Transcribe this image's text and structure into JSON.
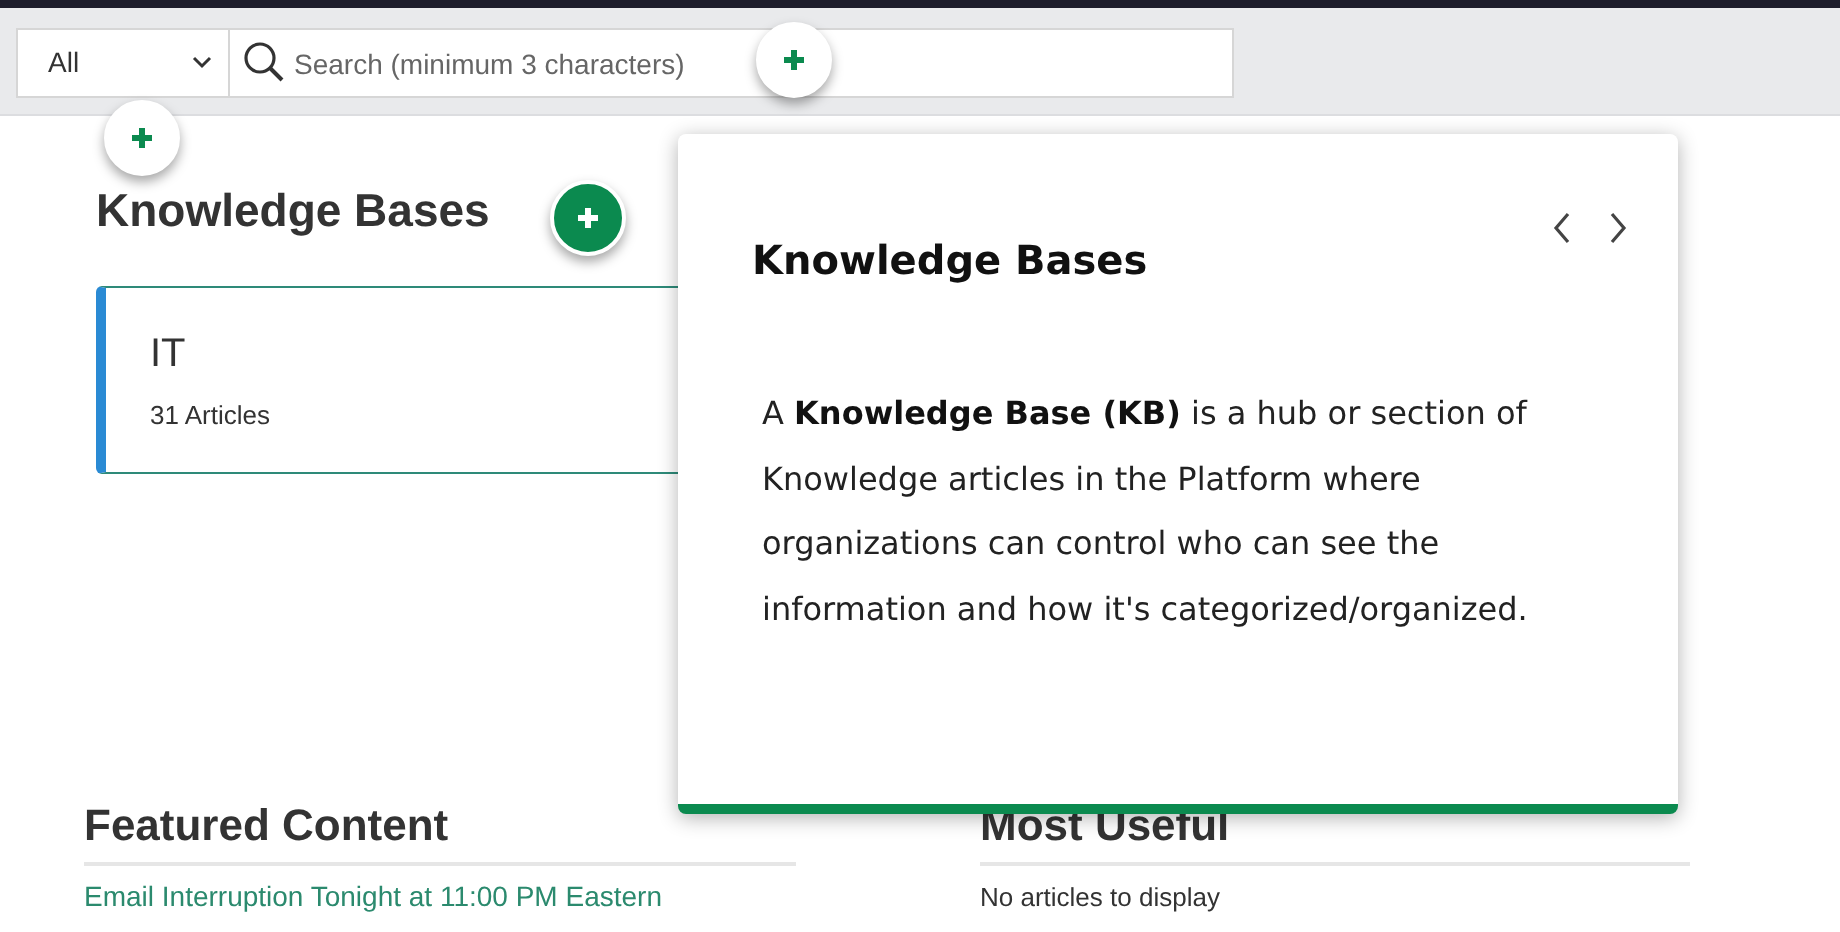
{
  "top_bar": {
    "filter": {
      "value": "All",
      "hotspot": {
        "selected": false
      }
    },
    "search": {
      "placeholder": "Search (minimum 3 characters)",
      "hotspot": {
        "selected": false
      }
    }
  },
  "knowledge_bases": {
    "heading": "Knowledge Bases",
    "hotspot": {
      "selected": true
    },
    "items": [
      {
        "name": "IT",
        "count": "31 Articles"
      }
    ]
  },
  "featured_content": {
    "heading": "Featured Content",
    "links": [
      "Email Interruption Tonight at 11:00 PM Eastern"
    ]
  },
  "most_useful": {
    "heading": "Most Useful",
    "empty_text": "No articles to display"
  },
  "popover": {
    "title": "Knowledge Bases",
    "body": "A **Knowledge Base (KB)** is a hub or section of Knowledge articles in the Platform where organizations can control who can see the information and how it's categorized/organized."
  }
}
